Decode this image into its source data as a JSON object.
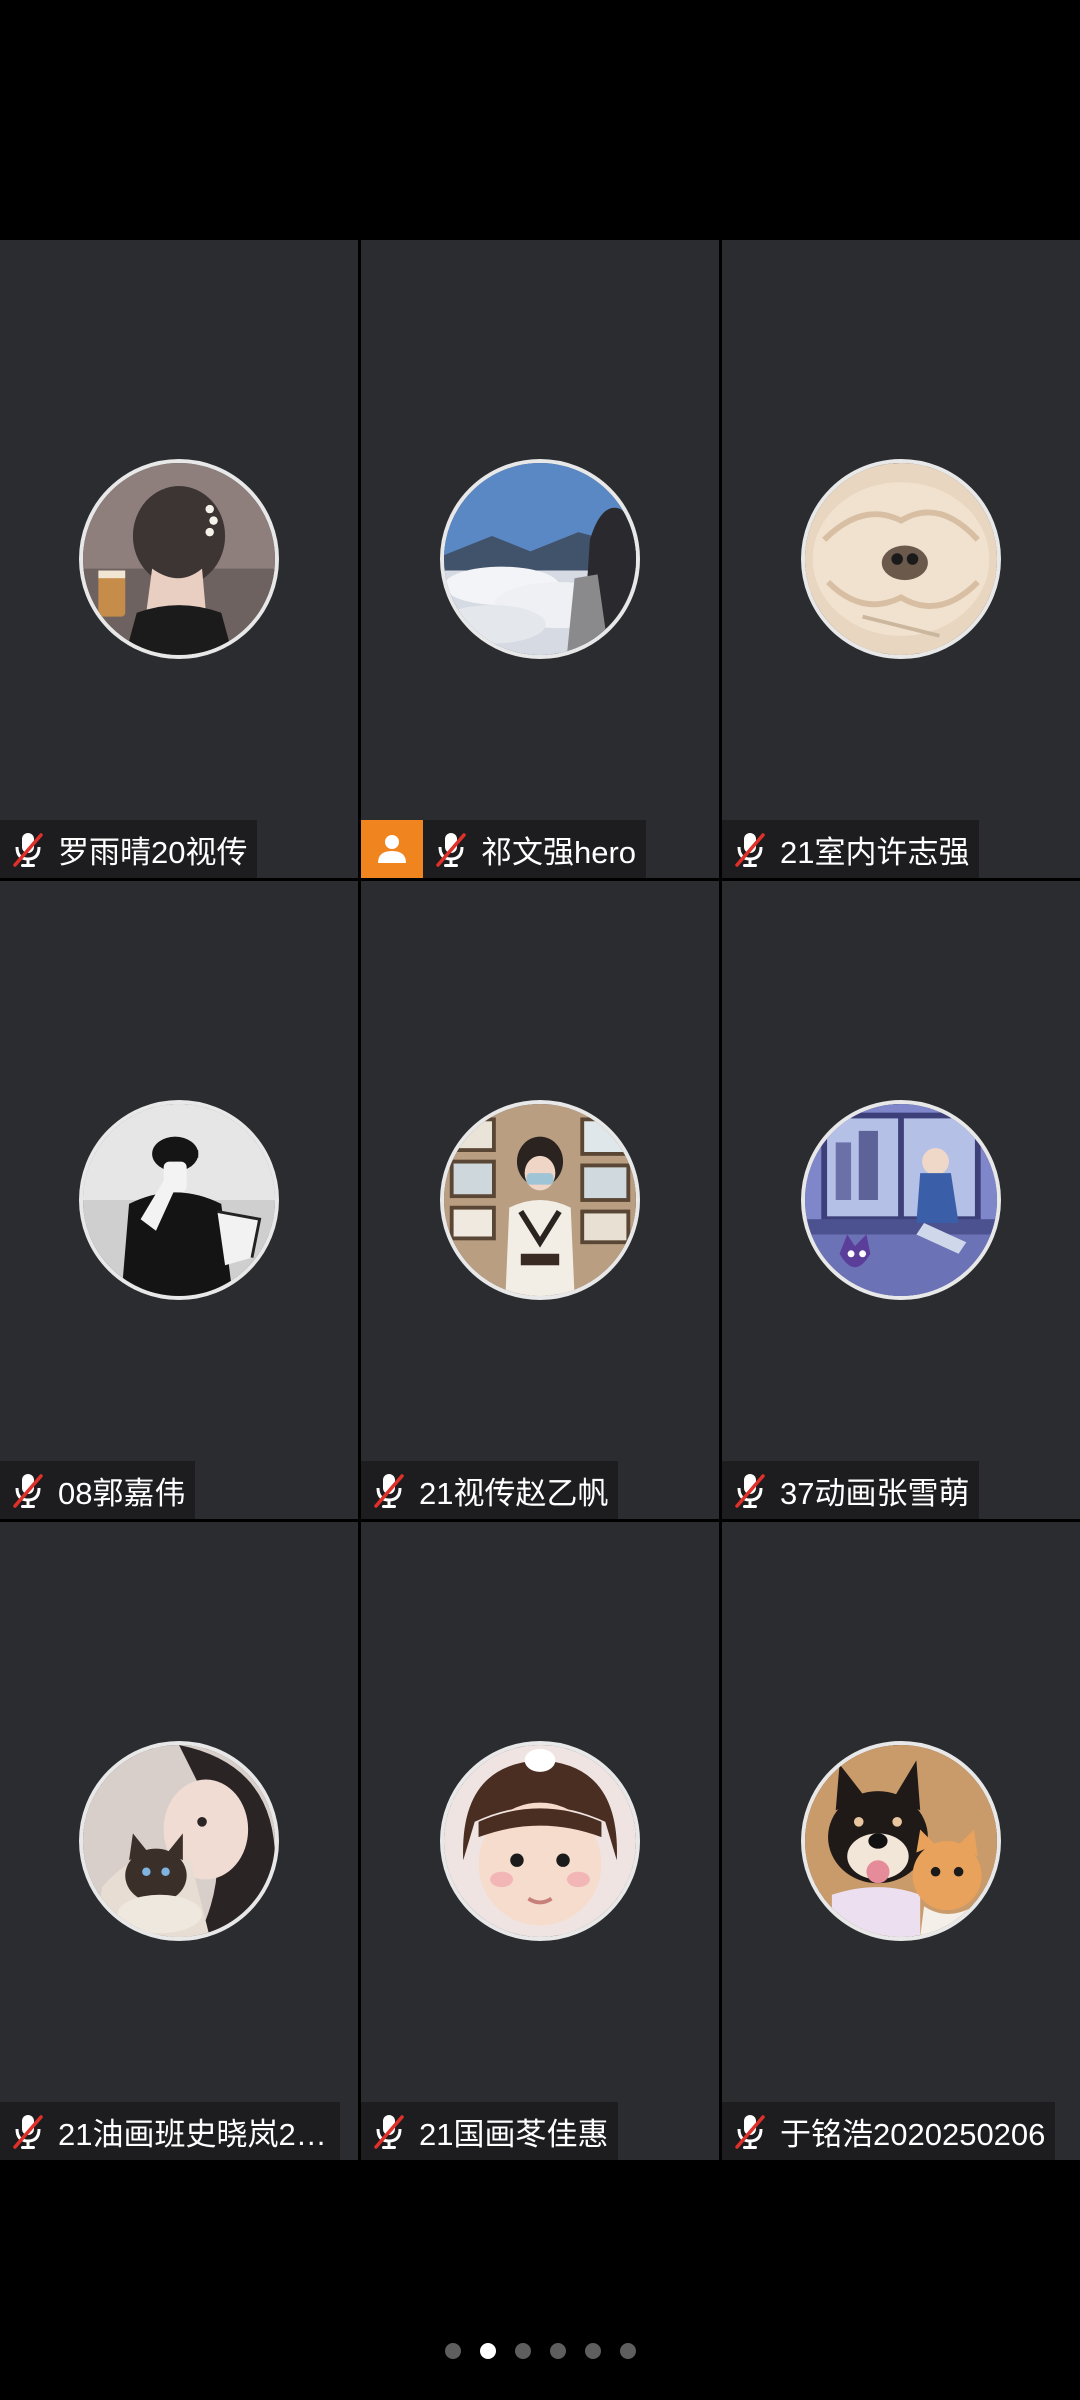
{
  "participants": [
    {
      "name": "罗雨晴20视传",
      "is_host": false,
      "mic": "muted-mic-icon",
      "avatar_icon": "woman-with-hair-clip-avatar"
    },
    {
      "name": "祁文强hero",
      "is_host": true,
      "mic": "muted-mic-icon",
      "avatar_icon": "mountain-clouds-avatar"
    },
    {
      "name": "21室内许志强",
      "is_host": false,
      "mic": "muted-mic-icon",
      "avatar_icon": "plush-toy-avatar"
    },
    {
      "name": "08郭嘉伟",
      "is_host": false,
      "mic": "muted-mic-icon",
      "avatar_icon": "cap-man-illustration-avatar"
    },
    {
      "name": "21视传赵乙帆",
      "is_host": false,
      "mic": "muted-mic-icon",
      "avatar_icon": "girl-in-gallery-avatar"
    },
    {
      "name": "37动画张雪萌",
      "is_host": false,
      "mic": "muted-mic-icon",
      "avatar_icon": "anime-window-illustration-avatar"
    },
    {
      "name": "21油画班史晓岚20...",
      "is_host": false,
      "mic": "muted-mic-icon",
      "avatar_icon": "woman-with-cat-avatar"
    },
    {
      "name": "21国画苳佳惠",
      "is_host": false,
      "mic": "muted-mic-icon",
      "avatar_icon": "toddler-face-avatar"
    },
    {
      "name": "于铭浩2020250206",
      "is_host": false,
      "mic": "muted-mic-icon",
      "avatar_icon": "dog-and-kitten-avatar"
    }
  ],
  "pagination": {
    "total_pages": 6,
    "current_page": 2
  },
  "colors": {
    "tile_background": "#2b2c30",
    "host_badge": "#f0841f",
    "mic_muted_slash": "#e0302a",
    "dot_active": "#ffffff",
    "dot_inactive": "#5e5e5e"
  }
}
